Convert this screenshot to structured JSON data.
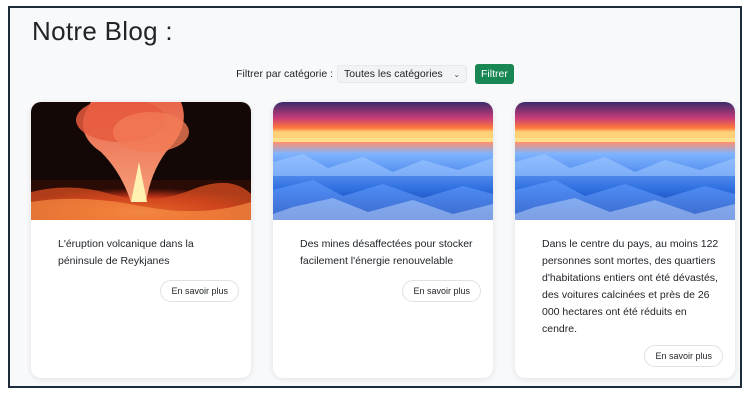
{
  "page": {
    "title": "Notre Blog :"
  },
  "filter": {
    "label": "Filtrer par catégorie :",
    "selected": "Toutes les catégories",
    "button_label": "Filtrer"
  },
  "cards": [
    {
      "image": "volcanic-eruption",
      "text": "L'éruption volcanique dans la péninsule de Reykjanes",
      "button_label": "En savoir plus"
    },
    {
      "image": "ice-sunset",
      "text": "Des mines désaffectées pour stocker facilement l'énergie renouvelable",
      "button_label": "En savoir plus"
    },
    {
      "image": "ice-sunset",
      "text": "Dans le centre du pays, au moins 122 personnes sont mortes, des quartiers d'habitations entiers ont été dévastés, des voitures calcinées et près de 26 000 hectares ont été réduits en cendre.",
      "button_label": "En savoir plus"
    }
  ],
  "colors": {
    "accent_green": "#198754",
    "text": "#212529",
    "frame_border": "#1d2b3a"
  }
}
